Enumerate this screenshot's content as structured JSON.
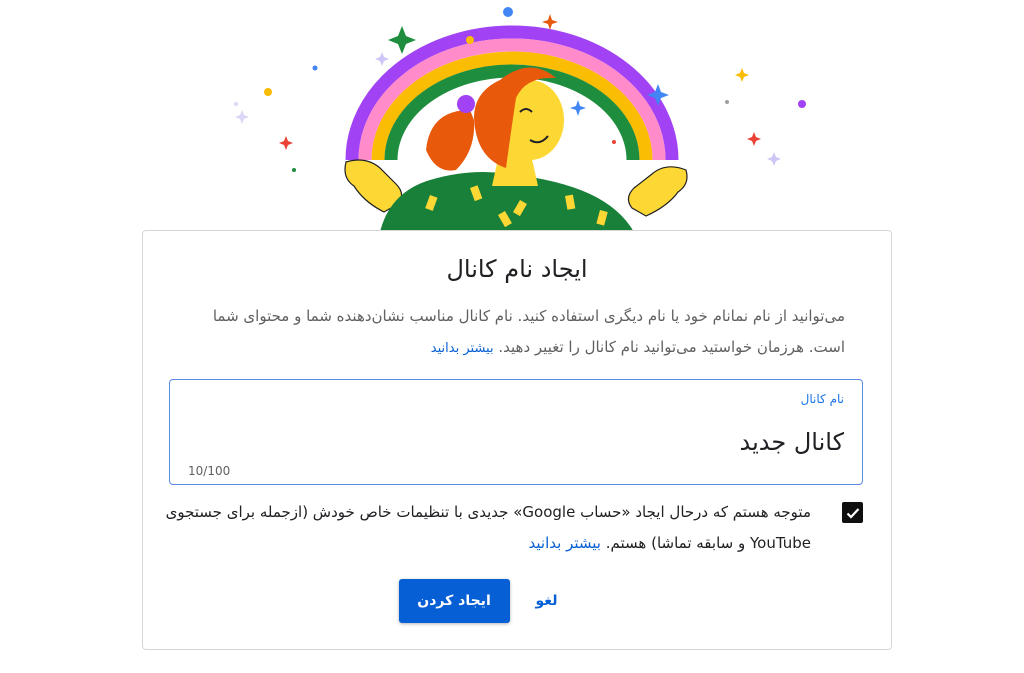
{
  "dialog": {
    "title": "ایجاد نام کانال",
    "description": "می‌توانید از نام نمانام خود یا نام دیگری استفاده کنید. نام کانال مناسب نشان‌دهنده شما و محتوای شما است. هرزمان خواستید می‌توانید نام کانال را تغییر دهید.",
    "learn_more": "بیشتر بدانید"
  },
  "channel_name_field": {
    "label": "نام کانال",
    "value": "کانال جدید",
    "counter": "10/100"
  },
  "consent": {
    "checked": true,
    "text": "متوجه هستم که درحال ایجاد «حساب Google» جدیدی با تنظیمات خاص خودش (ازجمله برای جستجوی YouTube و سابقه تماشا) هستم.",
    "learn_more": "بیشتر بدانید"
  },
  "actions": {
    "create_label": "ایجاد کردن",
    "cancel_label": "لغو"
  },
  "colors": {
    "accent": "#065fd4",
    "checkbox": "#0f0f0f",
    "field_border": "#5b8ee6"
  },
  "icons": {
    "checkbox": "checkmark-icon",
    "illustration": "rainbow-person-illustration"
  }
}
